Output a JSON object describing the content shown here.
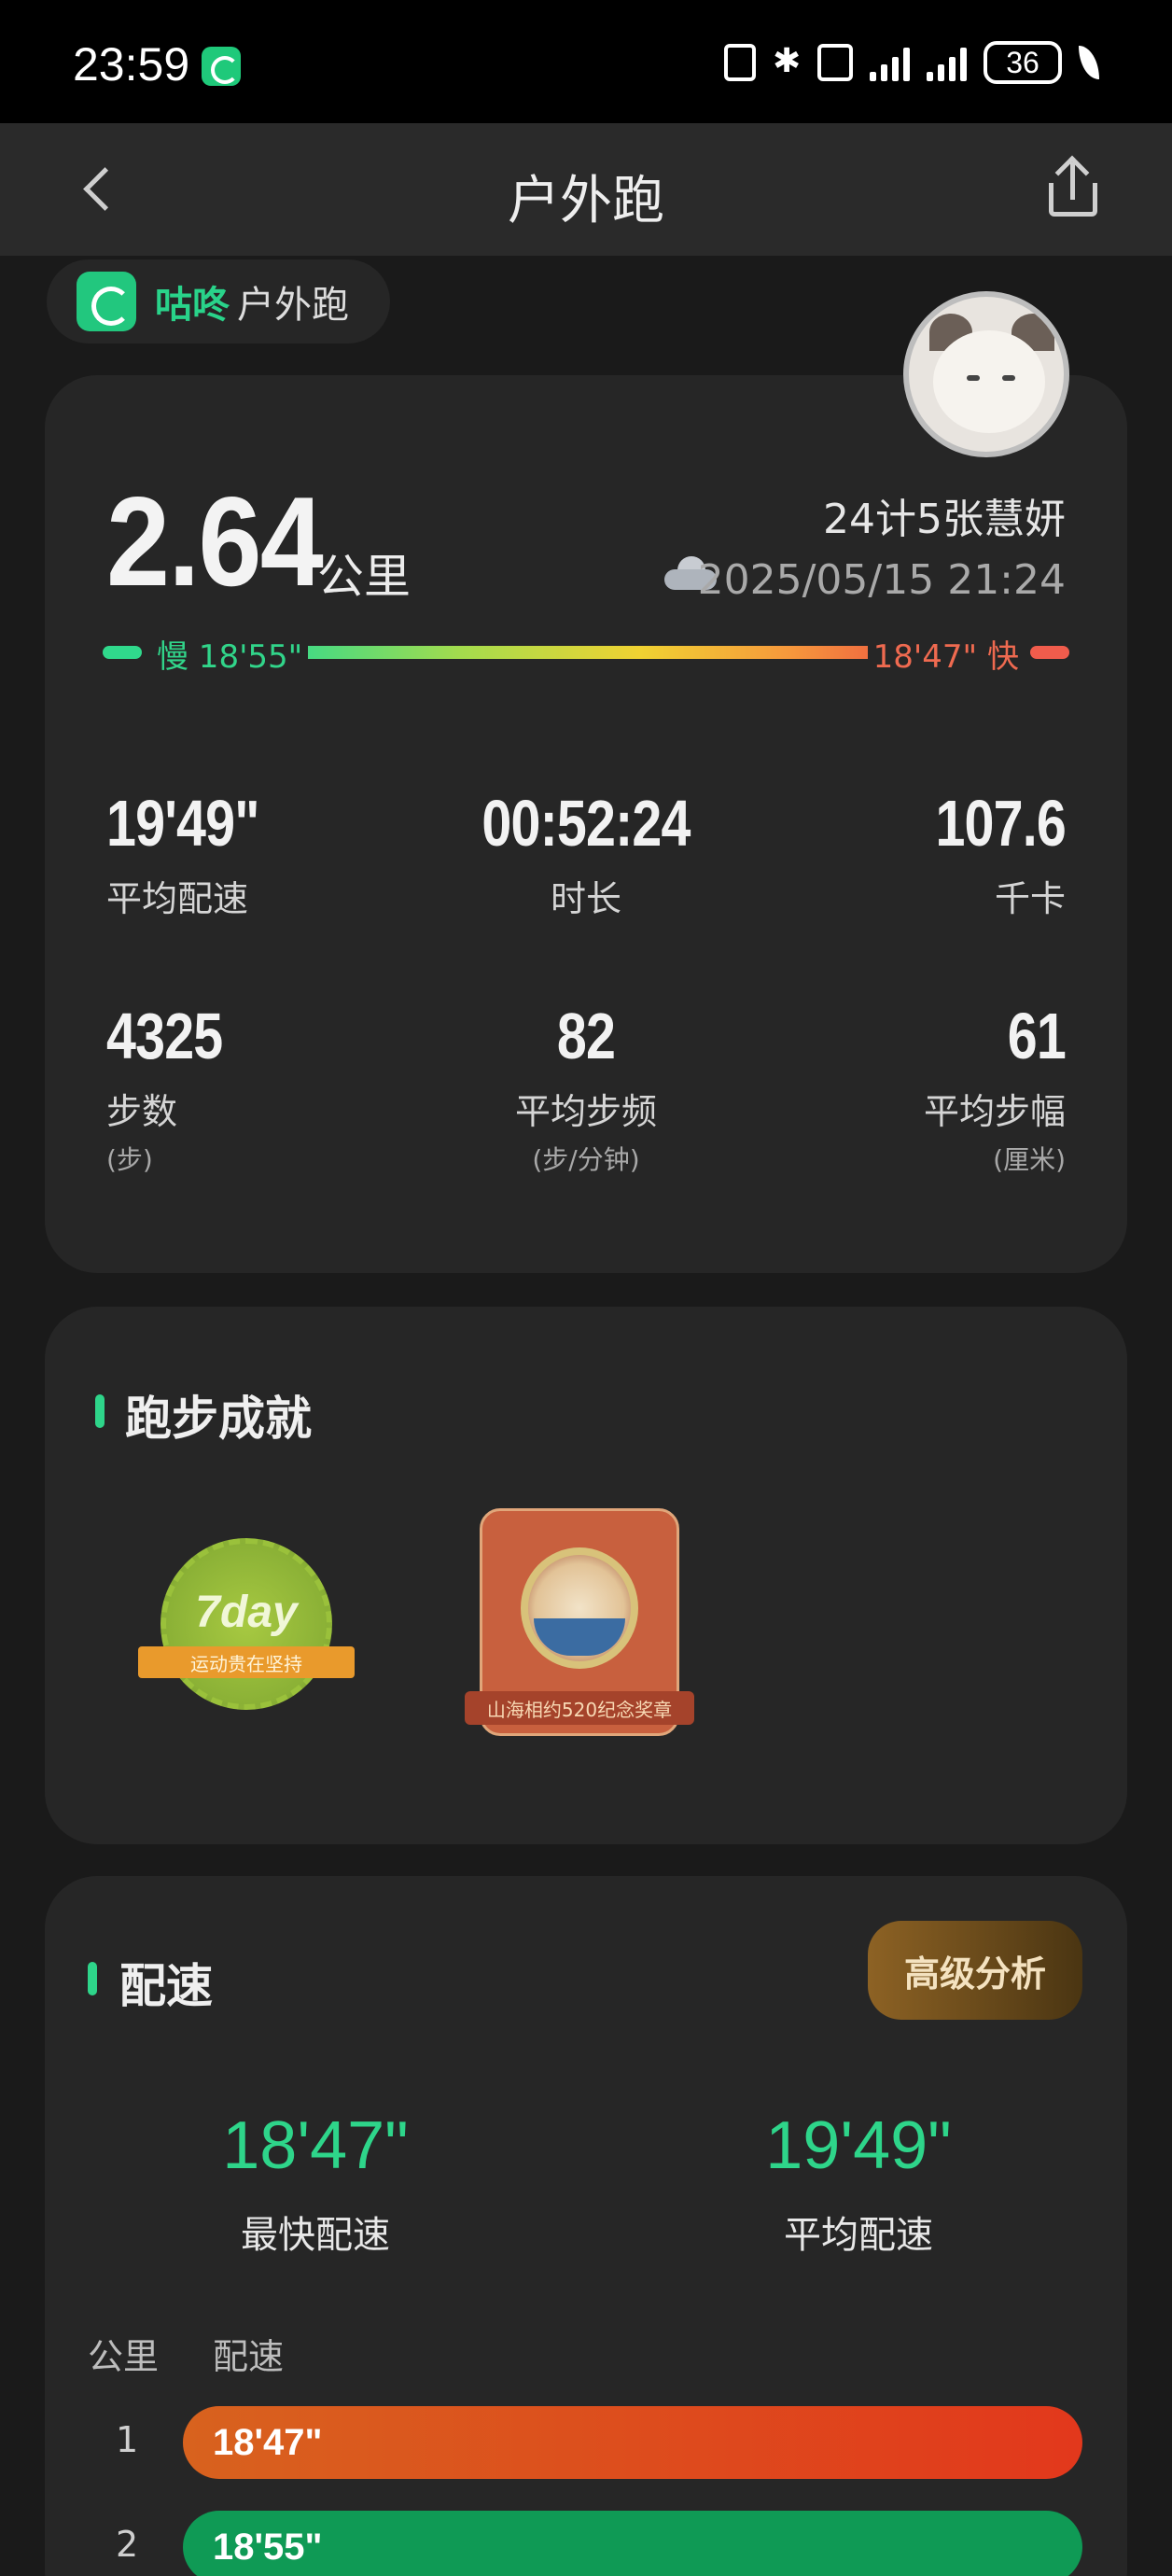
{
  "status_bar": {
    "time": "23:59",
    "battery": "36"
  },
  "header": {
    "title": "户外跑"
  },
  "source": {
    "brand": "咕咚",
    "type": "户外跑"
  },
  "summary": {
    "distance": "2.64",
    "distance_unit": "公里",
    "user_name": "24计5张慧妍",
    "datetime": "2025/05/15 21:24",
    "slow_label": "慢 18'55\"",
    "fast_label": "18'47\" 快",
    "stats": {
      "avg_pace": {
        "value": "19'49\"",
        "label": "平均配速"
      },
      "duration": {
        "value": "00:52:24",
        "label": "时长"
      },
      "calories": {
        "value": "107.6",
        "label": "千卡"
      },
      "steps": {
        "value": "4325",
        "label": "步数",
        "unit": "(步)"
      },
      "cadence": {
        "value": "82",
        "label": "平均步频",
        "unit": "(步/分钟)"
      },
      "stride": {
        "value": "61",
        "label": "平均步幅",
        "unit": "(厘米)"
      }
    }
  },
  "achievements": {
    "title": "跑步成就",
    "badges": [
      {
        "name": "7day",
        "ribbon": "运动贵在坚持"
      },
      {
        "name": "medal",
        "ribbon": "山海相约520纪念奖章"
      }
    ]
  },
  "pace": {
    "title": "配速",
    "advanced_button": "高级分析",
    "fastest": {
      "value": "18'47\"",
      "label": "最快配速"
    },
    "average": {
      "value": "19'49\"",
      "label": "平均配速"
    },
    "col_km": "公里",
    "col_pace": "配速",
    "splits": [
      {
        "km": "1",
        "pace": "18'47\"",
        "color": "#e03a1e"
      },
      {
        "km": "2",
        "pace": "18'55\"",
        "color": "#0f9a55"
      }
    ]
  }
}
